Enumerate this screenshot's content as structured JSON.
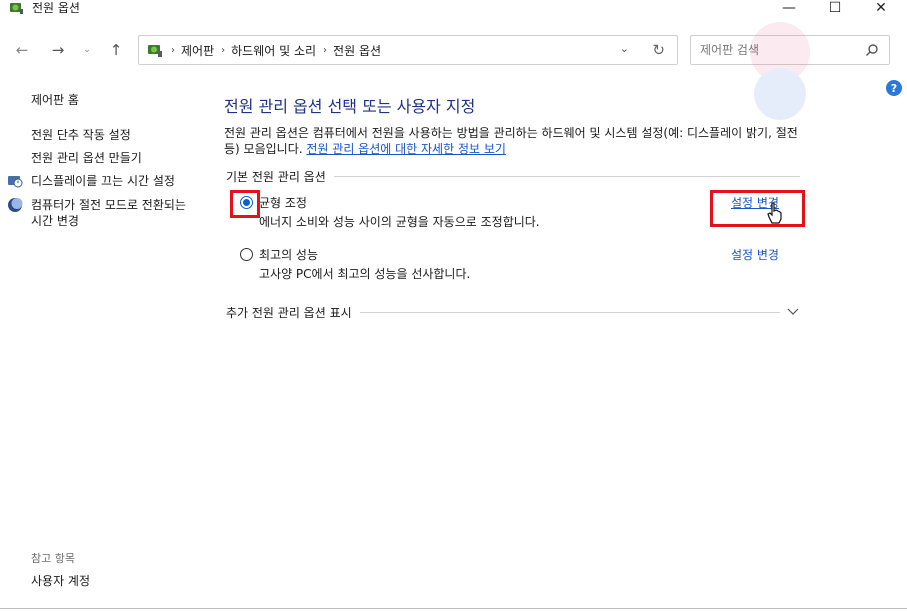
{
  "window": {
    "title": "전원 옵션",
    "minimize_glyph": "—",
    "maximize_glyph": "☐",
    "close_glyph": "✕"
  },
  "nav": {
    "back_glyph": "←",
    "forward_glyph": "→",
    "recent_glyph": "⌄",
    "up_glyph": "↑"
  },
  "address": {
    "crumbs": [
      "제어판",
      "하드웨어 및 소리",
      "전원 옵션"
    ],
    "separator": "›",
    "dropdown_glyph": "⌄",
    "refresh_glyph": "↻"
  },
  "search": {
    "placeholder": "제어판 검색",
    "value": ""
  },
  "help_glyph": "?",
  "sidebar": {
    "home": "제어판 홈",
    "links": [
      {
        "label": "전원 단추 작동 설정",
        "icon": "none"
      },
      {
        "label": "전원 관리 옵션 만들기",
        "icon": "none"
      },
      {
        "label": "디스플레이를 끄는 시간 설정",
        "icon": "monitor-clock-icon"
      },
      {
        "label": "컴퓨터가 절전 모드로 전환되는 시간 변경",
        "icon": "moon-icon"
      }
    ],
    "see_also_title": "참고 항목",
    "see_also": [
      "사용자 계정"
    ]
  },
  "main": {
    "heading": "전원 관리 옵션 선택 또는 사용자 지정",
    "description": "전원 관리 옵션은 컴퓨터에서 전원을 사용하는 방법을 관리하는 하드웨어 및 시스템 설정(예: 디스플레이 밝기, 절전 등) 모음입니다.",
    "description_link": "전원 관리 옵션에 대한 자세한 정보 보기",
    "group_label": "기본 전원 관리 옵션",
    "plans": [
      {
        "name": "균형 조정",
        "desc": "에너지 소비와 성능 사이의 균형을 자동으로 조정합니다.",
        "link": "설정 변경",
        "selected": true
      },
      {
        "name": "최고의 성능",
        "desc": "고사양 PC에서 최고의 성능을 선사합니다.",
        "link": "설정 변경",
        "selected": false
      }
    ],
    "more_label": "추가 전원 관리 옵션 표시"
  },
  "colors": {
    "heading": "#1e3287",
    "link": "#1a55c7",
    "highlight": "#e3111c",
    "radio": "#0a5fd1"
  }
}
